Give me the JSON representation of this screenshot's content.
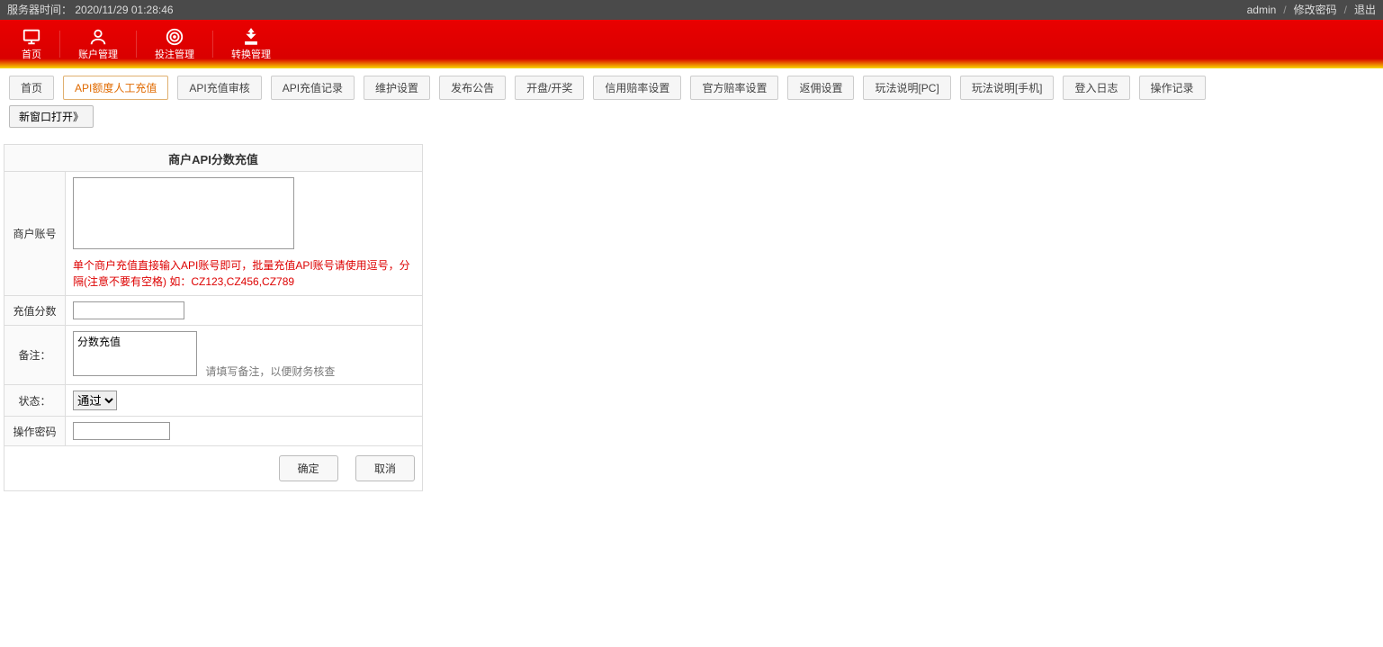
{
  "topbar": {
    "server_time_label": "服务器时间：",
    "server_time_value": "2020/11/29 01:28:46",
    "user": "admin",
    "change_pwd": "修改密码",
    "logout": "退出"
  },
  "nav": [
    {
      "label": "首页",
      "icon": "monitor"
    },
    {
      "label": "账户管理",
      "icon": "user"
    },
    {
      "label": "投注管理",
      "icon": "target"
    },
    {
      "label": "转换管理",
      "icon": "money"
    }
  ],
  "tabs": [
    {
      "label": "首页",
      "active": false
    },
    {
      "label": "API额度人工充值",
      "active": true
    },
    {
      "label": "API充值审核",
      "active": false
    },
    {
      "label": "API充值记录",
      "active": false
    },
    {
      "label": "维护设置",
      "active": false
    },
    {
      "label": "发布公告",
      "active": false
    },
    {
      "label": "开盘/开奖",
      "active": false
    },
    {
      "label": "信用赔率设置",
      "active": false
    },
    {
      "label": "官方赔率设置",
      "active": false
    },
    {
      "label": "返佣设置",
      "active": false
    },
    {
      "label": "玩法说明[PC]",
      "active": false
    },
    {
      "label": "玩法说明[手机]",
      "active": false
    },
    {
      "label": "登入日志",
      "active": false
    },
    {
      "label": "操作记录",
      "active": false
    }
  ],
  "sub_button": "新窗口打开》",
  "form": {
    "title": "商户API分数充值",
    "rows": {
      "account_label": "商户账号",
      "account_value": "",
      "account_hint": "单个商户充值直接输入API账号即可，批量充值API账号请使用逗号，分隔(注意不要有空格) 如：CZ123,CZ456,CZ789",
      "score_label": "充值分数",
      "score_value": "",
      "remark_label": "备注：",
      "remark_value": "分数充值",
      "remark_hint": "请填写备注，以便财务核查",
      "status_label": "状态：",
      "status_options": [
        "通过"
      ],
      "status_value": "通过",
      "oppwd_label": "操作密码",
      "oppwd_value": ""
    },
    "buttons": {
      "ok": "确定",
      "cancel": "取消"
    }
  }
}
